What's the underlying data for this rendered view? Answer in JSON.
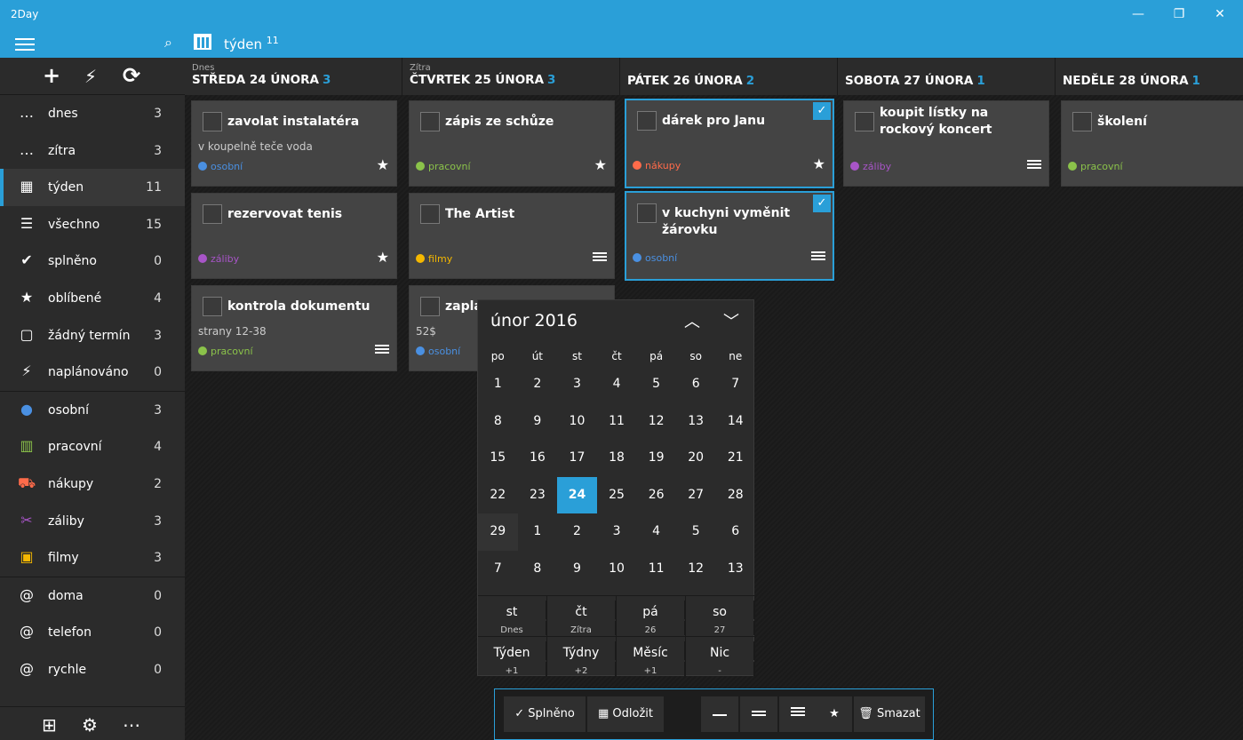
{
  "window": {
    "title": "2Day",
    "min": "—",
    "max": "❐",
    "close": "✕"
  },
  "appbar": {
    "view": "týden",
    "view_count": "11"
  },
  "sidebar": {
    "actions": [
      "+",
      "⚡",
      "⟳"
    ],
    "items": [
      {
        "label": "dnes",
        "count": "3",
        "icon": "today-icon",
        "glyph": "…"
      },
      {
        "label": "zítra",
        "count": "3",
        "icon": "tomorrow-icon",
        "glyph": "…"
      },
      {
        "label": "týden",
        "count": "11",
        "icon": "calendar-icon",
        "glyph": "▦",
        "selected": true
      },
      {
        "label": "všechno",
        "count": "15",
        "icon": "list-icon",
        "glyph": "☰"
      },
      {
        "label": "splněno",
        "count": "0",
        "icon": "check-icon",
        "glyph": "✔"
      },
      {
        "label": "oblíbené",
        "count": "4",
        "icon": "star-icon",
        "glyph": "★"
      },
      {
        "label": "žádný termín",
        "count": "3",
        "icon": "no-date-icon",
        "glyph": "▢"
      },
      {
        "label": "naplánováno",
        "count": "0",
        "icon": "lightning-icon",
        "glyph": "⚡"
      },
      {
        "label": "osobní",
        "count": "3",
        "icon": "person-icon",
        "glyph": "●",
        "color": "#4a90e2"
      },
      {
        "label": "pracovní",
        "count": "4",
        "icon": "building-icon",
        "glyph": "▥",
        "color": "#8bc34a"
      },
      {
        "label": "nákupy",
        "count": "2",
        "icon": "cart-icon",
        "glyph": "⛟",
        "color": "#ff6b4a"
      },
      {
        "label": "záliby",
        "count": "3",
        "icon": "hobby-icon",
        "glyph": "✂",
        "color": "#a855c8"
      },
      {
        "label": "filmy",
        "count": "3",
        "icon": "picture-icon",
        "glyph": "▣",
        "color": "#f5b800"
      },
      {
        "label": "doma",
        "count": "0",
        "icon": "at-icon",
        "glyph": "@"
      },
      {
        "label": "telefon",
        "count": "0",
        "icon": "at-icon",
        "glyph": "@"
      },
      {
        "label": "rychle",
        "count": "0",
        "icon": "at-icon",
        "glyph": "@"
      }
    ],
    "bottom": [
      "⊞",
      "⚙",
      "⋯"
    ]
  },
  "days": [
    {
      "sub": "Dnes",
      "name": "STŘEDA 24 ÚNORA",
      "count": "3"
    },
    {
      "sub": "Zítra",
      "name": "ČTVRTEK 25 ÚNORA",
      "count": "3"
    },
    {
      "sub": "",
      "name": "PÁTEK 26 ÚNORA",
      "count": "2"
    },
    {
      "sub": "",
      "name": "SOBOTA 27 ÚNORA",
      "count": "1"
    },
    {
      "sub": "",
      "name": "NEDĚLE 28 ÚNORA",
      "count": "1"
    }
  ],
  "tasks": [
    {
      "title": "zavolat instalatéra",
      "note": "v koupelně teče voda",
      "tag": "osobní",
      "tag_color": "#4a90e2",
      "prio": "star"
    },
    {
      "title": "rezervovat tenis",
      "note": "",
      "tag": "záliby",
      "tag_color": "#a855c8",
      "prio": "star"
    },
    {
      "title": "kontrola dokumentu",
      "note": "strany 12-38",
      "tag": "pracovní",
      "tag_color": "#8bc34a",
      "prio": "high"
    },
    {
      "title": "zápis ze schůze",
      "note": "",
      "tag": "pracovní",
      "tag_color": "#8bc34a",
      "prio": "star"
    },
    {
      "title": "The Artist",
      "note": "",
      "tag": "filmy",
      "tag_color": "#f5b800",
      "prio": "high"
    },
    {
      "title": "zaplat",
      "note": "52$",
      "tag": "osobní",
      "tag_color": "#4a90e2",
      "prio": ""
    },
    {
      "title": "dárek pro Janu",
      "note": "",
      "tag": "nákupy",
      "tag_color": "#ff6b4a",
      "prio": "star",
      "selected": true
    },
    {
      "title": "v kuchyni vyměnit žárovku",
      "note": "",
      "tag": "osobní",
      "tag_color": "#4a90e2",
      "prio": "high",
      "selected": true
    },
    {
      "title": "koupit lístky na rockový koncert",
      "note": "",
      "tag": "záliby",
      "tag_color": "#a855c8",
      "prio": "high"
    },
    {
      "title": "školení",
      "note": "",
      "tag": "pracovní",
      "tag_color": "#8bc34a",
      "prio": ""
    }
  ],
  "picker": {
    "month": "únor 2016",
    "weekdays": [
      "po",
      "út",
      "st",
      "čt",
      "pá",
      "so",
      "ne"
    ],
    "weeks": [
      [
        "1",
        "2",
        "3",
        "4",
        "5",
        "6",
        "7"
      ],
      [
        "8",
        "9",
        "10",
        "11",
        "12",
        "13",
        "14"
      ],
      [
        "15",
        "16",
        "17",
        "18",
        "19",
        "20",
        "21"
      ],
      [
        "22",
        "23",
        "24",
        "25",
        "26",
        "27",
        "28"
      ],
      [
        "29",
        "1",
        "2",
        "3",
        "4",
        "5",
        "6"
      ],
      [
        "7",
        "8",
        "9",
        "10",
        "11",
        "12",
        "13"
      ]
    ],
    "today": "24",
    "quick1": [
      {
        "a": "st",
        "b": "Dnes"
      },
      {
        "a": "čt",
        "b": "Zítra"
      },
      {
        "a": "pá",
        "b": "26"
      },
      {
        "a": "so",
        "b": "27"
      }
    ],
    "quick2": [
      {
        "a": "Týden",
        "b": "+1"
      },
      {
        "a": "Týdny",
        "b": "+2"
      },
      {
        "a": "Měsíc",
        "b": "+1"
      },
      {
        "a": "Nic",
        "b": "-"
      }
    ]
  },
  "actions": {
    "done": "Splněno",
    "postpone": "Odložit",
    "delete": "Smazat"
  },
  "colors": {
    "accent": "#2a9fd8"
  }
}
